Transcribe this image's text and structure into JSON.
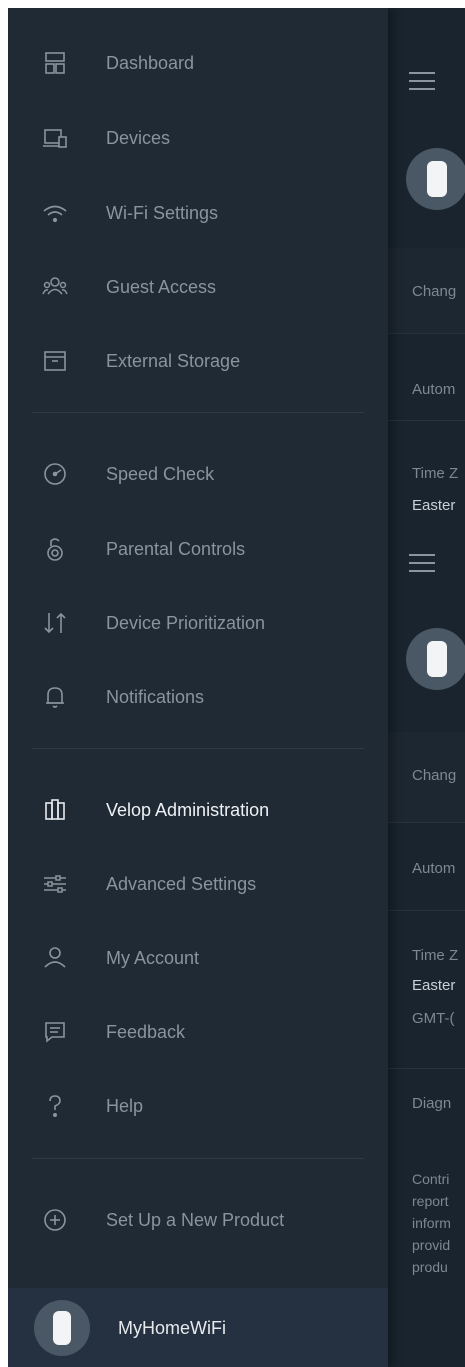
{
  "menu": {
    "items": [
      {
        "label": "Dashboard",
        "icon": "dashboard-icon"
      },
      {
        "label": "Devices",
        "icon": "devices-icon"
      },
      {
        "label": "Wi-Fi Settings",
        "icon": "wifi-icon"
      },
      {
        "label": "Guest Access",
        "icon": "guest-access-icon"
      },
      {
        "label": "External Storage",
        "icon": "external-storage-icon"
      },
      {
        "label": "Speed Check",
        "icon": "speed-check-icon"
      },
      {
        "label": "Parental Controls",
        "icon": "parental-controls-icon"
      },
      {
        "label": "Device Prioritization",
        "icon": "device-prioritization-icon"
      },
      {
        "label": "Notifications",
        "icon": "bell-icon"
      },
      {
        "label": "Velop Administration",
        "icon": "velop-node-icon",
        "active": true
      },
      {
        "label": "Advanced Settings",
        "icon": "sliders-icon"
      },
      {
        "label": "My Account",
        "icon": "user-icon"
      },
      {
        "label": "Feedback",
        "icon": "feedback-icon"
      },
      {
        "label": "Help",
        "icon": "help-icon"
      },
      {
        "label": "Set Up a New Product",
        "icon": "plus-circle-icon"
      }
    ],
    "colors": {
      "drawer_bg": "#1f2a35",
      "label": "#8a949d",
      "active_label": "#eef1f3"
    }
  },
  "network": {
    "name": "MyHomeWiFi",
    "icon": "velop-node-icon"
  },
  "behind": {
    "top": {
      "change": "Chang",
      "auto": "Autom",
      "timezone_label": "Time Z",
      "timezone_value": "Easter"
    },
    "bottom": {
      "change": "Chang",
      "auto": "Autom",
      "timezone_label": "Time Z",
      "timezone_value": "Easter",
      "gmt": "GMT-(",
      "diagnostics": "Diagn",
      "description": [
        "Contri",
        "report",
        "inform",
        "provid",
        "produ"
      ]
    }
  }
}
